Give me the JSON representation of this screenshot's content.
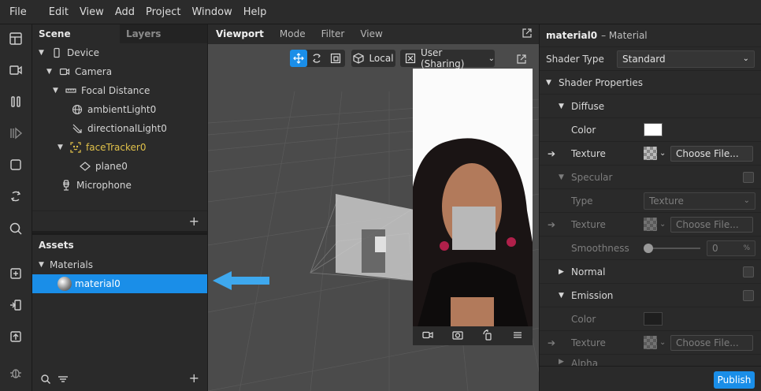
{
  "menu": [
    "File",
    "Edit",
    "View",
    "Add",
    "Project",
    "Window",
    "Help"
  ],
  "toolbar_icons": [
    "layout-icon",
    "video-icon",
    "pause-icon",
    "step-forward-icon",
    "stop-icon",
    "refresh-icon",
    "search-icon",
    "add-box-icon",
    "import-icon",
    "upload-icon",
    "bug-icon"
  ],
  "scene": {
    "tabs": [
      "Scene",
      "Layers"
    ],
    "tree": [
      {
        "label": "Device",
        "icon": "phone-icon",
        "depth": 0,
        "expanded": true
      },
      {
        "label": "Camera",
        "icon": "camera-icon",
        "depth": 1,
        "expanded": true
      },
      {
        "label": "Focal Distance",
        "icon": "ruler-icon",
        "depth": 2,
        "expanded": true
      },
      {
        "label": "ambientLight0",
        "icon": "globe-icon",
        "depth": 3
      },
      {
        "label": "directionalLight0",
        "icon": "directional-light-icon",
        "depth": 3
      },
      {
        "label": "faceTracker0",
        "icon": "face-tracker-icon",
        "depth": 2,
        "expanded": true,
        "highlight": true
      },
      {
        "label": "plane0",
        "icon": "plane-icon",
        "depth": 4
      },
      {
        "label": "Microphone",
        "icon": "microphone-icon",
        "depth": 1
      }
    ],
    "add_label": "+"
  },
  "assets": {
    "title": "Assets",
    "group": "Materials",
    "items": [
      {
        "label": "material0",
        "selected": true
      }
    ],
    "add_label": "+"
  },
  "viewport": {
    "tabs": [
      "Viewport",
      "Mode",
      "Filter",
      "View"
    ],
    "local_label": "Local",
    "camera_label": "User (Sharing)"
  },
  "inspector": {
    "title": "material0",
    "subtitle": "– Material",
    "shader_type_label": "Shader Type",
    "shader_type_value": "Standard",
    "shader_props": "Shader Properties",
    "diffuse": "Diffuse",
    "color": "Color",
    "texture": "Texture",
    "choose_file": "Choose File...",
    "specular": "Specular",
    "type": "Type",
    "type_value": "Texture",
    "smoothness": "Smoothness",
    "smoothness_value": "0",
    "percent": "%",
    "normal": "Normal",
    "emission": "Emission",
    "alpha_partial": "Alpha",
    "publish": "Publish"
  },
  "colors": {
    "accent": "#1a8ee8",
    "highlight": "#e0c14a"
  }
}
